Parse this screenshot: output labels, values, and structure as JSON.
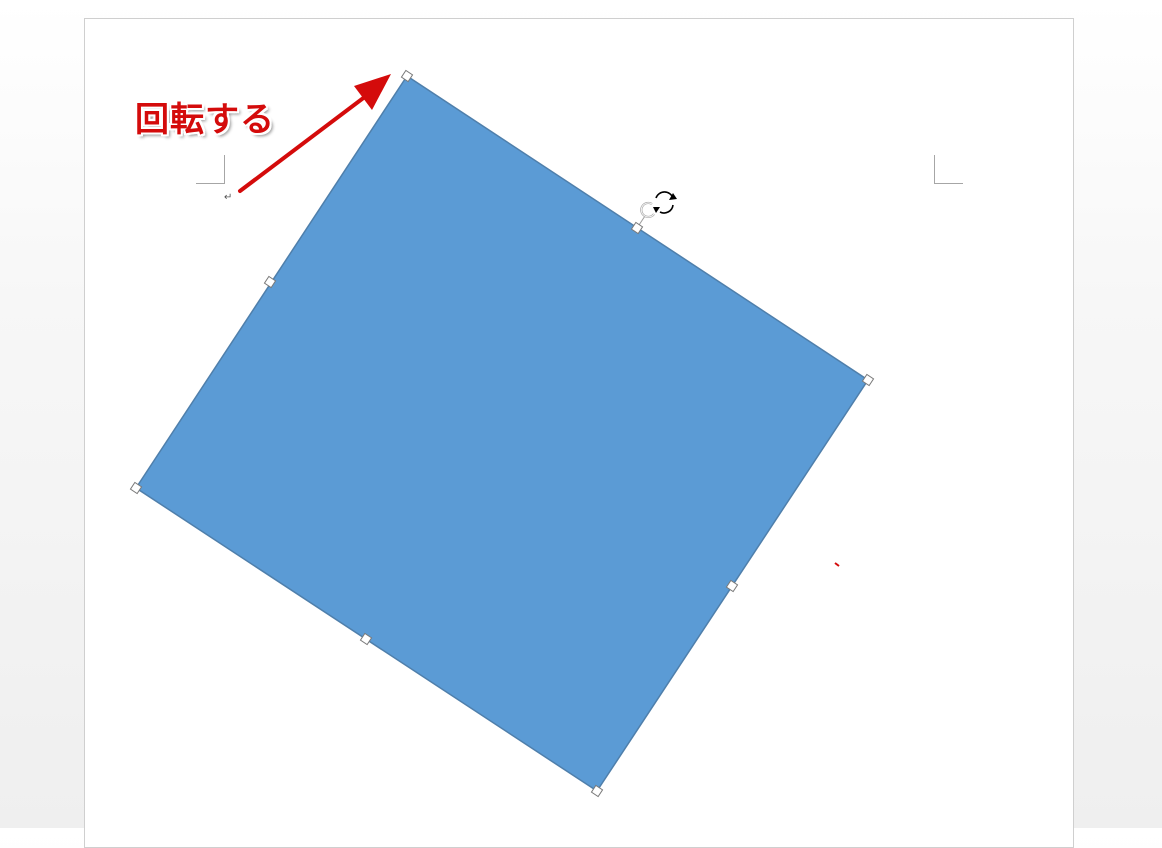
{
  "annotation": {
    "label": "回転する",
    "color": "#d40b0b"
  },
  "document": {
    "paragraph_mark": "↵"
  },
  "shape": {
    "type": "rectangle",
    "state": "selected-rotated",
    "fill_color": "#5b9bd5",
    "border_color": "#4f7fab"
  },
  "icons": {
    "rotate_handle": "rotate-handle-icon",
    "rotate_cursor": "rotate-cursor-icon",
    "arrow": "arrow-icon"
  }
}
